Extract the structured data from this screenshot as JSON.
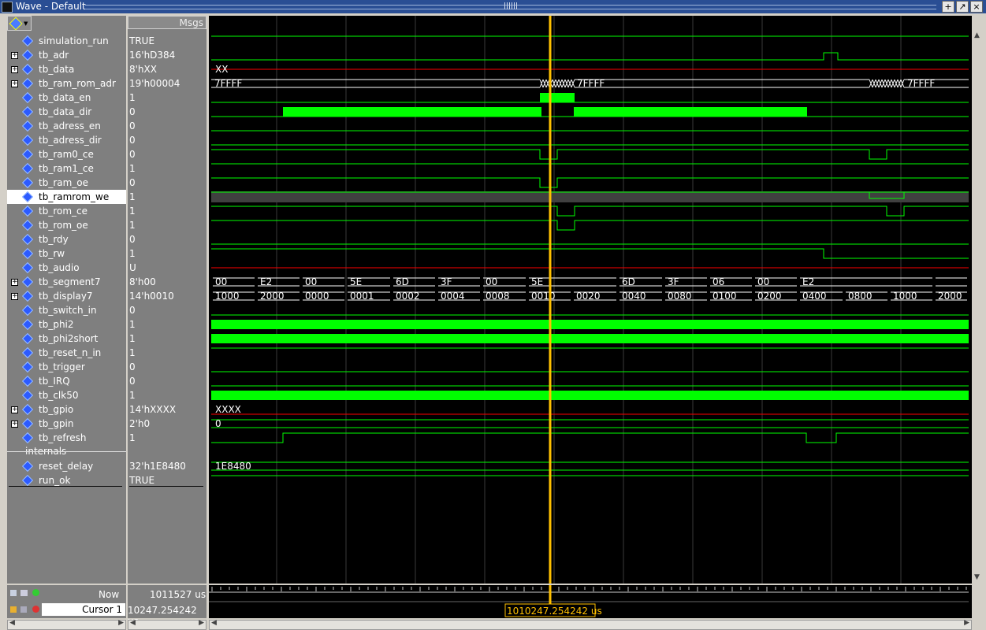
{
  "window": {
    "title": "Wave - Default"
  },
  "header": {
    "msgs_label": "Msgs"
  },
  "signals": [
    {
      "name": "simulation_run",
      "value": "TRUE",
      "expandable": false
    },
    {
      "name": "tb_adr",
      "value": "16'hD384",
      "expandable": true
    },
    {
      "name": "tb_data",
      "value": "8'hXX",
      "expandable": true
    },
    {
      "name": "tb_ram_rom_adr",
      "value": "19'h00004",
      "expandable": true
    },
    {
      "name": "tb_data_en",
      "value": "1",
      "expandable": false
    },
    {
      "name": "tb_data_dir",
      "value": "0",
      "expandable": false
    },
    {
      "name": "tb_adress_en",
      "value": "0",
      "expandable": false
    },
    {
      "name": "tb_adress_dir",
      "value": "0",
      "expandable": false
    },
    {
      "name": "tb_ram0_ce",
      "value": "0",
      "expandable": false
    },
    {
      "name": "tb_ram1_ce",
      "value": "1",
      "expandable": false
    },
    {
      "name": "tb_ram_oe",
      "value": "0",
      "expandable": false
    },
    {
      "name": "tb_ramrom_we",
      "value": "1",
      "expandable": false,
      "selected": true
    },
    {
      "name": "tb_rom_ce",
      "value": "1",
      "expandable": false
    },
    {
      "name": "tb_rom_oe",
      "value": "1",
      "expandable": false
    },
    {
      "name": "tb_rdy",
      "value": "0",
      "expandable": false
    },
    {
      "name": "tb_rw",
      "value": "1",
      "expandable": false
    },
    {
      "name": "tb_audio",
      "value": "U",
      "expandable": false
    },
    {
      "name": "tb_segment7",
      "value": "8'h00",
      "expandable": true
    },
    {
      "name": "tb_display7",
      "value": "14'h0010",
      "expandable": true
    },
    {
      "name": "tb_switch_in",
      "value": "0",
      "expandable": false
    },
    {
      "name": "tb_phi2",
      "value": "1",
      "expandable": false
    },
    {
      "name": "tb_phi2short",
      "value": "1",
      "expandable": false
    },
    {
      "name": "tb_reset_n_in",
      "value": "1",
      "expandable": false
    },
    {
      "name": "tb_trigger",
      "value": "0",
      "expandable": false
    },
    {
      "name": "tb_IRQ",
      "value": "0",
      "expandable": false
    },
    {
      "name": "tb_clk50",
      "value": "1",
      "expandable": false
    },
    {
      "name": "tb_gpio",
      "value": "14'hXXXX",
      "expandable": true
    },
    {
      "name": "tb_gpin",
      "value": "2'h0",
      "expandable": true
    },
    {
      "name": "tb_refresh",
      "value": "1",
      "expandable": false
    }
  ],
  "group": {
    "label": "internals"
  },
  "internals": [
    {
      "name": "reset_delay",
      "value": "32'h1E8480",
      "expandable": false
    },
    {
      "name": "run_ok",
      "value": "TRUE",
      "expandable": false
    }
  ],
  "wave_labels": {
    "tb_data": "XX",
    "ram_rom_adr": [
      "7FFFF",
      "7FFFF",
      "7FFFF"
    ],
    "segment7": [
      "00",
      "E2",
      "00",
      "5E",
      "6D",
      "3F",
      "00",
      "5E",
      "6D",
      "3F",
      "06",
      "00",
      "E2"
    ],
    "display7": [
      "1000",
      "2000",
      "0000",
      "0001",
      "0002",
      "0004",
      "0008",
      "0010",
      "0020",
      "0040",
      "0080",
      "0100",
      "0200",
      "0400",
      "0800",
      "1000",
      "2000"
    ],
    "gpio": "XXXX",
    "gpin": "0",
    "reset_delay": "1E8480"
  },
  "footer": {
    "now_label": "Now",
    "now_value": "1011527 us",
    "cursor_label": "Cursor 1",
    "cursor_value": "10247.254242 us",
    "cursor_flag": "1010247.254242 us"
  },
  "colors": {
    "wave": "#00ff00",
    "cursor": "#ffc000",
    "undef": "#ff0000",
    "bus": "#ffffff",
    "selected_row": "#404040"
  }
}
